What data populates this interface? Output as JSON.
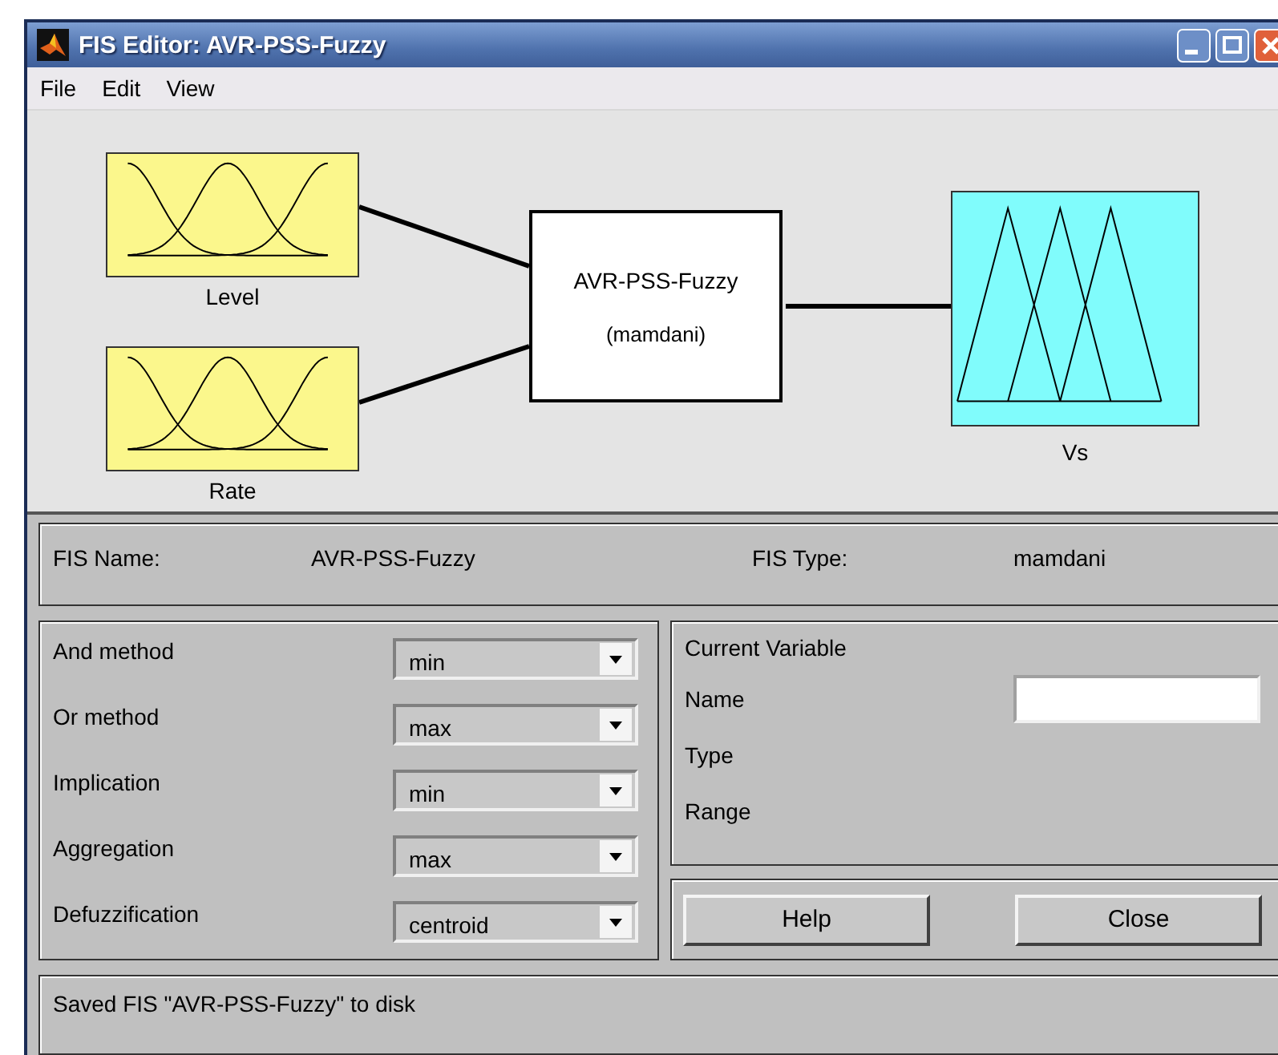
{
  "window": {
    "title": "FIS Editor: AVR-PSS-Fuzzy"
  },
  "menu": [
    "File",
    "Edit",
    "View"
  ],
  "diagram": {
    "inputs": [
      {
        "name": "Level",
        "kind": "gaussian"
      },
      {
        "name": "Rate",
        "kind": "gaussian"
      }
    ],
    "system": {
      "name": "AVR-PSS-Fuzzy",
      "type": "(mamdani)"
    },
    "outputs": [
      {
        "name": "Vs",
        "kind": "triangular"
      }
    ]
  },
  "fis_info": {
    "name_label": "FIS Name:",
    "name_value": "AVR-PSS-Fuzzy",
    "type_label": "FIS Type:",
    "type_value": "mamdani"
  },
  "methods": [
    {
      "label": "And method",
      "value": "min"
    },
    {
      "label": "Or method",
      "value": "max"
    },
    {
      "label": "Implication",
      "value": "min"
    },
    {
      "label": "Aggregation",
      "value": "max"
    },
    {
      "label": "Defuzzification",
      "value": "centroid"
    }
  ],
  "current_variable": {
    "title": "Current Variable",
    "fields": [
      {
        "label": "Name",
        "kind": "input"
      },
      {
        "label": "Type",
        "kind": "text"
      },
      {
        "label": "Range",
        "kind": "text"
      }
    ]
  },
  "buttons": [
    "Help",
    "Close"
  ],
  "status": "Saved FIS \"AVR-PSS-Fuzzy\" to disk"
}
